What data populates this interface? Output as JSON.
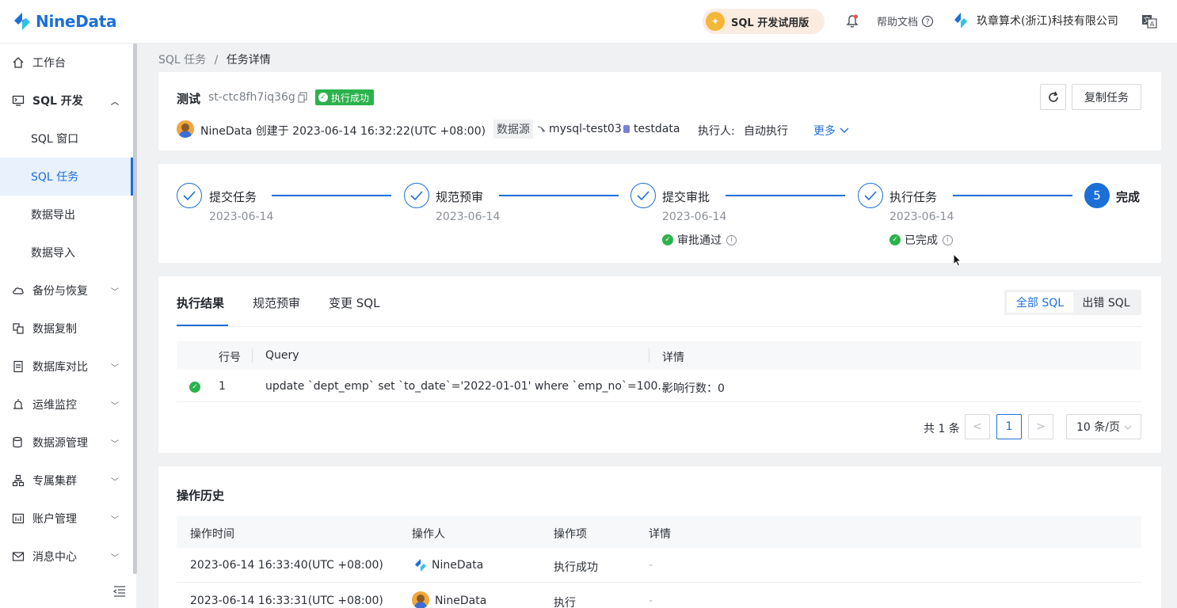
{
  "header": {
    "brand": "NineData",
    "trial_label": "SQL 开发试用版",
    "help_label": "帮助文档",
    "company": "玖章算术(浙江)科技有限公司"
  },
  "sidebar": {
    "items": [
      {
        "label": "工作台",
        "icon": "home-icon"
      },
      {
        "label": "SQL 开发",
        "icon": "monitor-icon",
        "expanded": true
      },
      {
        "label": "SQL 窗口"
      },
      {
        "label": "SQL 任务",
        "active": true
      },
      {
        "label": "数据导出"
      },
      {
        "label": "数据导入"
      },
      {
        "label": "备份与恢复",
        "icon": "cloud-backup-icon"
      },
      {
        "label": "数据复制",
        "icon": "replicate-icon"
      },
      {
        "label": "数据库对比",
        "icon": "compare-icon"
      },
      {
        "label": "运维监控",
        "icon": "monitor-alarm-icon"
      },
      {
        "label": "数据源管理",
        "icon": "datasource-icon"
      },
      {
        "label": "专属集群",
        "icon": "cluster-icon"
      },
      {
        "label": "账户管理",
        "icon": "account-icon"
      },
      {
        "label": "消息中心",
        "icon": "mail-icon"
      }
    ]
  },
  "breadcrumb": {
    "parent": "SQL 任务",
    "separator": "/",
    "current": "任务详情"
  },
  "task": {
    "title": "测试",
    "id": "st-ctc8fh7iq36g",
    "status": "执行成功",
    "creator_line": "NineData 创建于 2023-06-14 16:32:22(UTC +08:00)",
    "datasource_label": "数据源",
    "datasource": "mysql-test03",
    "database": "testdata",
    "executor_label": "执行人:",
    "executor": "自动执行",
    "more_label": "更多",
    "copy_task_label": "复制任务"
  },
  "steps": [
    {
      "title": "提交任务",
      "date": "2023-06-14"
    },
    {
      "title": "规范预审",
      "date": "2023-06-14"
    },
    {
      "title": "提交审批",
      "date": "2023-06-14",
      "status": "审批通过"
    },
    {
      "title": "执行任务",
      "date": "2023-06-14",
      "status": "已完成"
    },
    {
      "title": "完成",
      "number": "5"
    }
  ],
  "tabs": [
    "执行结果",
    "规范预审",
    "变更 SQL"
  ],
  "filter": {
    "all": "全部 SQL",
    "error": "出错 SQL"
  },
  "results": {
    "headers": [
      "行号",
      "Query",
      "详情"
    ],
    "rows": [
      {
        "row": "1",
        "query": "update `dept_emp` set `to_date`='2022-01-01' where `emp_no`=100...",
        "detail": "影响行数：0"
      }
    ]
  },
  "pagination": {
    "total": "共 1 条",
    "prev": "<",
    "page": "1",
    "next": ">",
    "page_size": "10 条/页"
  },
  "history": {
    "title": "操作历史",
    "headers": [
      "操作时间",
      "操作人",
      "操作项",
      "详情"
    ],
    "rows": [
      {
        "time": "2023-06-14 16:33:40(UTC +08:00)",
        "operator": "NineData",
        "action": "执行成功",
        "detail": "-"
      },
      {
        "time": "2023-06-14 16:33:31(UTC +08:00)",
        "operator": "NineData",
        "action": "执行",
        "detail": "-"
      }
    ]
  },
  "colors": {
    "accent": "#1c6fd6",
    "success": "#2bb24c"
  }
}
